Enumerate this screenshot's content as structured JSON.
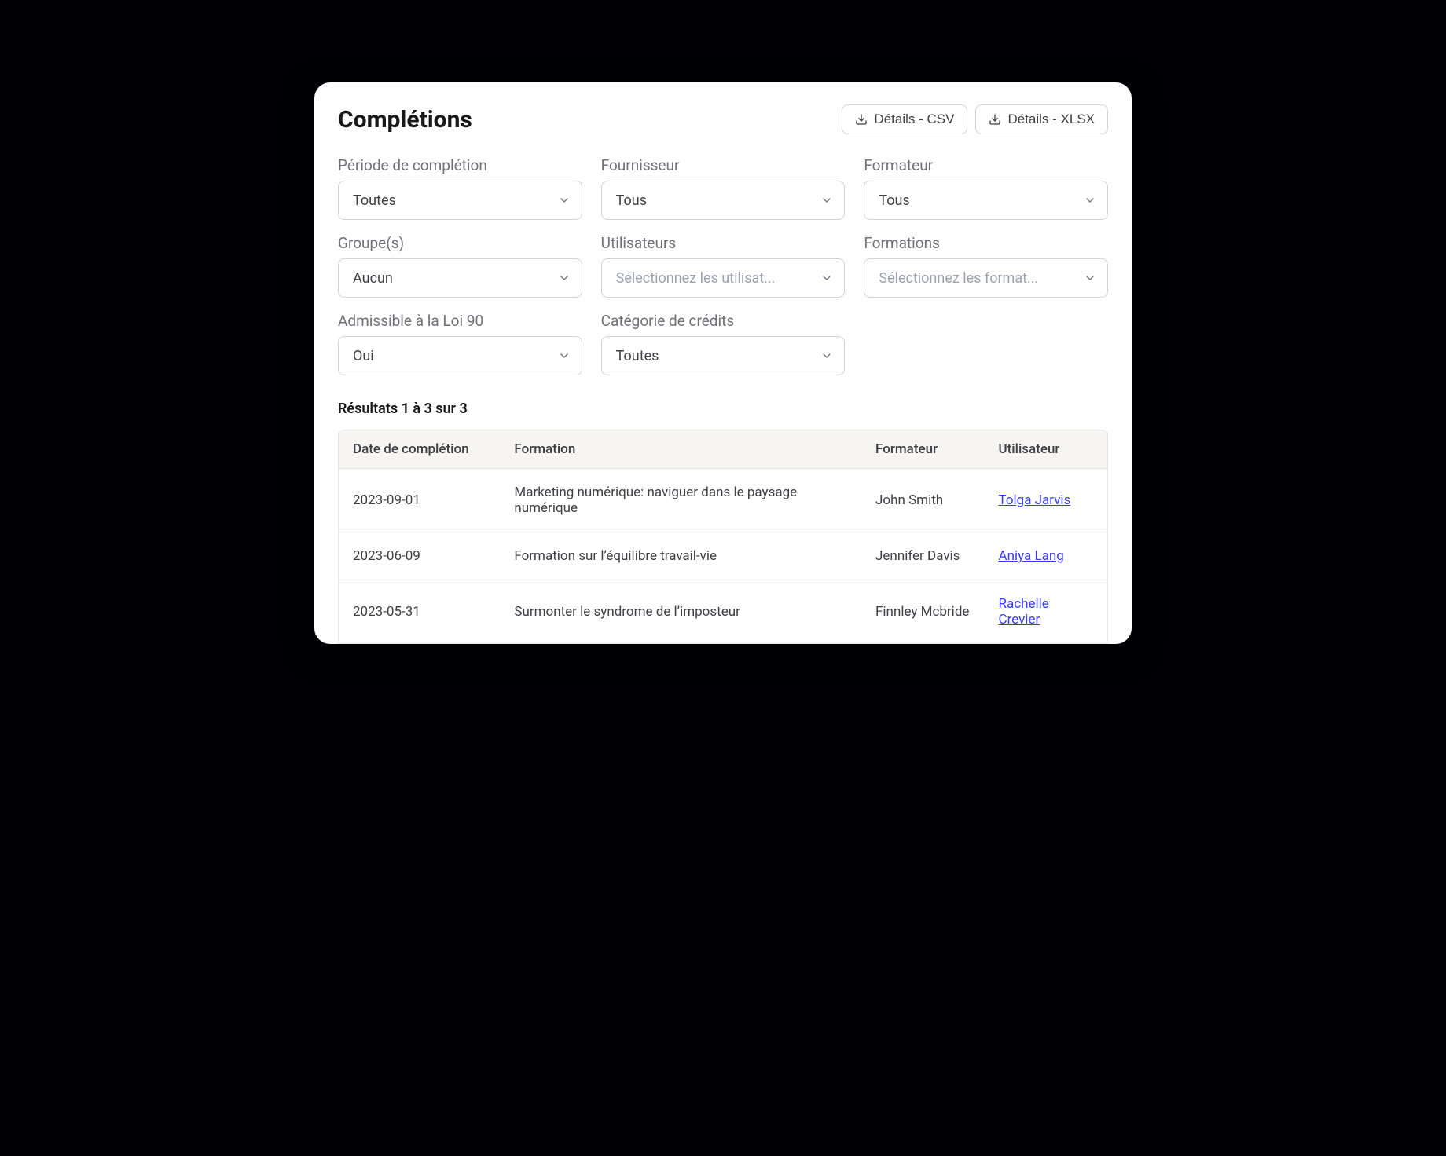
{
  "header": {
    "title": "Complétions",
    "export_csv_label": "Détails - CSV",
    "export_xlsx_label": "Détails - XLSX"
  },
  "filters": {
    "completion_period": {
      "label": "Période de complétion",
      "value": "Toutes"
    },
    "provider": {
      "label": "Fournisseur",
      "value": "Tous"
    },
    "trainer": {
      "label": "Formateur",
      "value": "Tous"
    },
    "groups": {
      "label": "Groupe(s)",
      "value": "Aucun"
    },
    "users": {
      "label": "Utilisateurs",
      "placeholder": "Sélectionnez les utilisat..."
    },
    "trainings": {
      "label": "Formations",
      "placeholder": "Sélectionnez les format..."
    },
    "law90": {
      "label": "Admissible à la Loi 90",
      "value": "Oui"
    },
    "credit_category": {
      "label": "Catégorie de crédits",
      "value": "Toutes"
    }
  },
  "results": {
    "summary": "Résultats 1 à 3 sur 3",
    "columns": {
      "date": "Date de complétion",
      "training": "Formation",
      "trainer": "Formateur",
      "user": "Utilisateur"
    },
    "rows": [
      {
        "date": "2023-09-01",
        "training": "Marketing numérique: naviguer dans le paysage numérique",
        "trainer": "John Smith",
        "user": "Tolga Jarvis"
      },
      {
        "date": "2023-06-09",
        "training": "Formation sur l’équilibre travail-vie",
        "trainer": "Jennifer Davis",
        "user": "Aniya Lang"
      },
      {
        "date": "2023-05-31",
        "training": "Surmonter le syndrome de l’imposteur",
        "trainer": "Finnley Mcbride",
        "user": "Rachelle Crevier"
      }
    ]
  }
}
